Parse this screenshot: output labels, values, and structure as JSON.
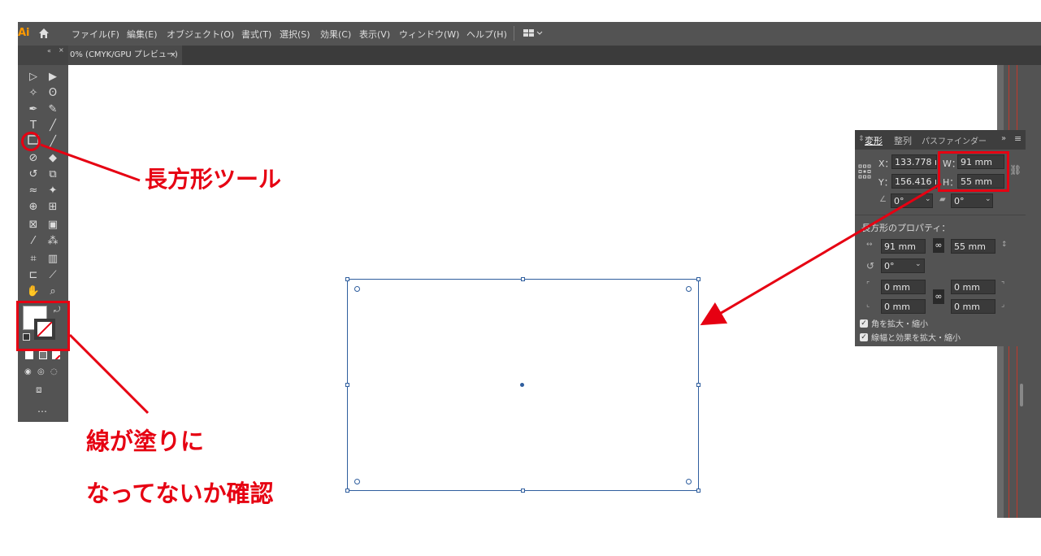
{
  "app": {
    "logo": "Ai"
  },
  "menu": [
    "ファイル(F)",
    "編集(E)",
    "オブジェクト(O)",
    "書式(T)",
    "選択(S)",
    "効果(C)",
    "表示(V)",
    "ウィンドウ(W)",
    "ヘルプ(H)"
  ],
  "tab": {
    "label": "0% (CMYK/GPU プレビュー)",
    "close": "×"
  },
  "transform_panel": {
    "tabs": [
      "変形",
      "整列",
      "パスファインダー"
    ],
    "x_label": "X：",
    "x_value": "133.778 m",
    "y_label": "Y：",
    "y_value": "156.416 m",
    "w_label": "W：",
    "w_value": "91 mm",
    "h_label": "H：",
    "h_value": "55 mm",
    "angle_value": "0°",
    "shear_value": "0°",
    "rect_props_title": "長方形のプロパティ：",
    "rect_w": "91 mm",
    "rect_h": "55 mm",
    "rotate_value": "0°",
    "corner_tl": "0 mm",
    "corner_tr": "0 mm",
    "corner_bl": "0 mm",
    "corner_br": "0 mm",
    "scale_corners": "角を拡大・縮小",
    "scale_strokes": "線幅と効果を拡大・縮小"
  },
  "annotations": {
    "rect_tool": "長方形ツール",
    "line1": "線が塗りに",
    "line2": "なってないか確認"
  },
  "colors": {
    "accent_red": "#e60012",
    "ui_dark": "#535353",
    "selection_blue": "#2f5e9e"
  }
}
